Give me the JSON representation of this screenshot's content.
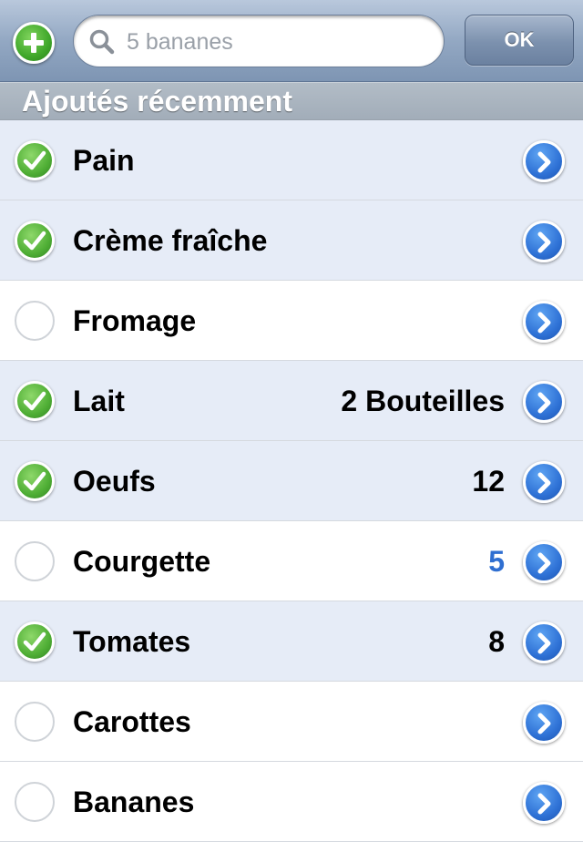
{
  "navbar": {
    "add_icon": "plus-circle-icon",
    "search": {
      "placeholder": "5 bananes",
      "value": "",
      "icon": "search-icon"
    },
    "ok_label": "OK"
  },
  "section": {
    "title": "Ajoutés récemment"
  },
  "items": [
    {
      "name": "Pain",
      "quantity": "",
      "checked": true
    },
    {
      "name": "Crème fraîche",
      "quantity": "",
      "checked": true
    },
    {
      "name": "Fromage",
      "quantity": "",
      "checked": false
    },
    {
      "name": "Lait",
      "quantity": "2 Bouteilles",
      "checked": true
    },
    {
      "name": "Oeufs",
      "quantity": "12",
      "checked": true
    },
    {
      "name": "Courgette",
      "quantity": "5",
      "checked": false,
      "quantity_color": "#2f6fd1"
    },
    {
      "name": "Tomates",
      "quantity": "8",
      "checked": true
    },
    {
      "name": "Carottes",
      "quantity": "",
      "checked": false
    },
    {
      "name": "Bananes",
      "quantity": "",
      "checked": false
    }
  ],
  "colors": {
    "checked_row": "#e6ecf7",
    "unchecked_row": "#ffffff",
    "check_green": "#4fae35",
    "detail_blue": "#2f72d6"
  }
}
